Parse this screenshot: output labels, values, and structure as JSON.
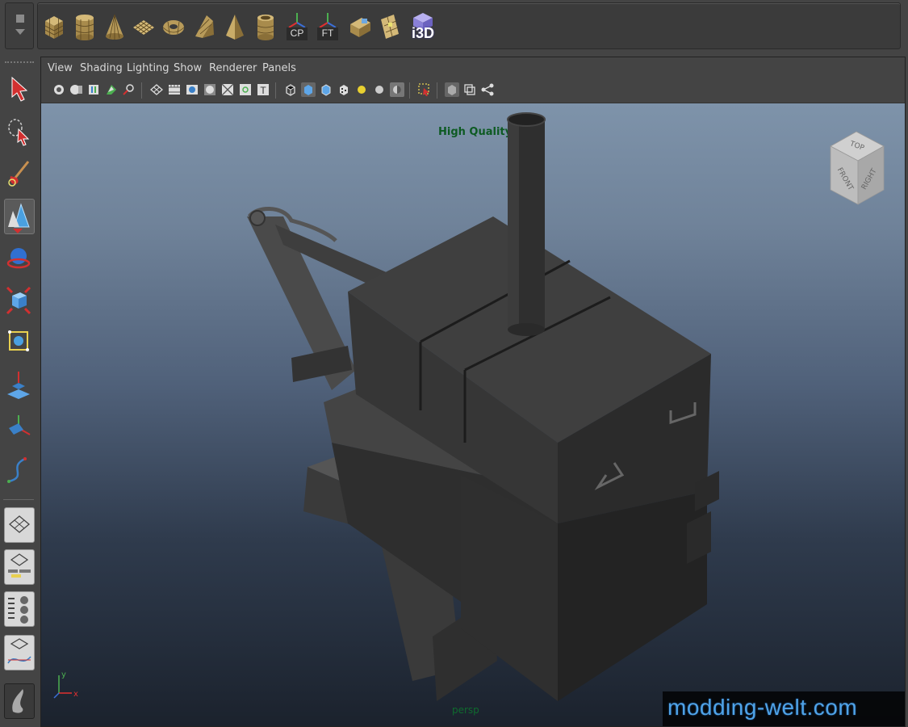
{
  "shelf": {
    "tabs_icon": "shelf-tabs",
    "icons": [
      {
        "name": "poly-cube-icon",
        "label": ""
      },
      {
        "name": "poly-cylinder-icon",
        "label": ""
      },
      {
        "name": "poly-cone-icon",
        "label": ""
      },
      {
        "name": "poly-plane-icon",
        "label": ""
      },
      {
        "name": "poly-torus-icon",
        "label": ""
      },
      {
        "name": "poly-prism-icon",
        "label": ""
      },
      {
        "name": "poly-pyramid-icon",
        "label": ""
      },
      {
        "name": "poly-pipe-icon",
        "label": ""
      },
      {
        "name": "center-pivot-icon",
        "label": "CP"
      },
      {
        "name": "freeze-transform-icon",
        "label": "FT"
      },
      {
        "name": "uv-box-icon",
        "label": ""
      },
      {
        "name": "uv-plane-icon",
        "label": ""
      },
      {
        "name": "i3d-export-icon",
        "label": "i3D"
      }
    ]
  },
  "menu": {
    "view": "View",
    "shading": "Shading",
    "lighting": "Lighting",
    "show": "Show",
    "renderer": "Renderer",
    "panels": "Panels"
  },
  "viewport": {
    "quality_label": "High Quality",
    "camera_label": "persp",
    "viewcube": {
      "top": "TOP",
      "front": "FRONT",
      "right": "RIGHT"
    },
    "axis": {
      "x": "x",
      "y": "y"
    },
    "background_top": "#7e93aa",
    "background_bottom": "#1b222d"
  },
  "watermark": "modding-welt.com",
  "colors": {
    "ui_bg": "#444444",
    "hq_text": "#0d5a22",
    "persp_text": "#0f6b2e",
    "watermark_text": "#4fa3e8",
    "model_gray": "#3f3f3f"
  }
}
